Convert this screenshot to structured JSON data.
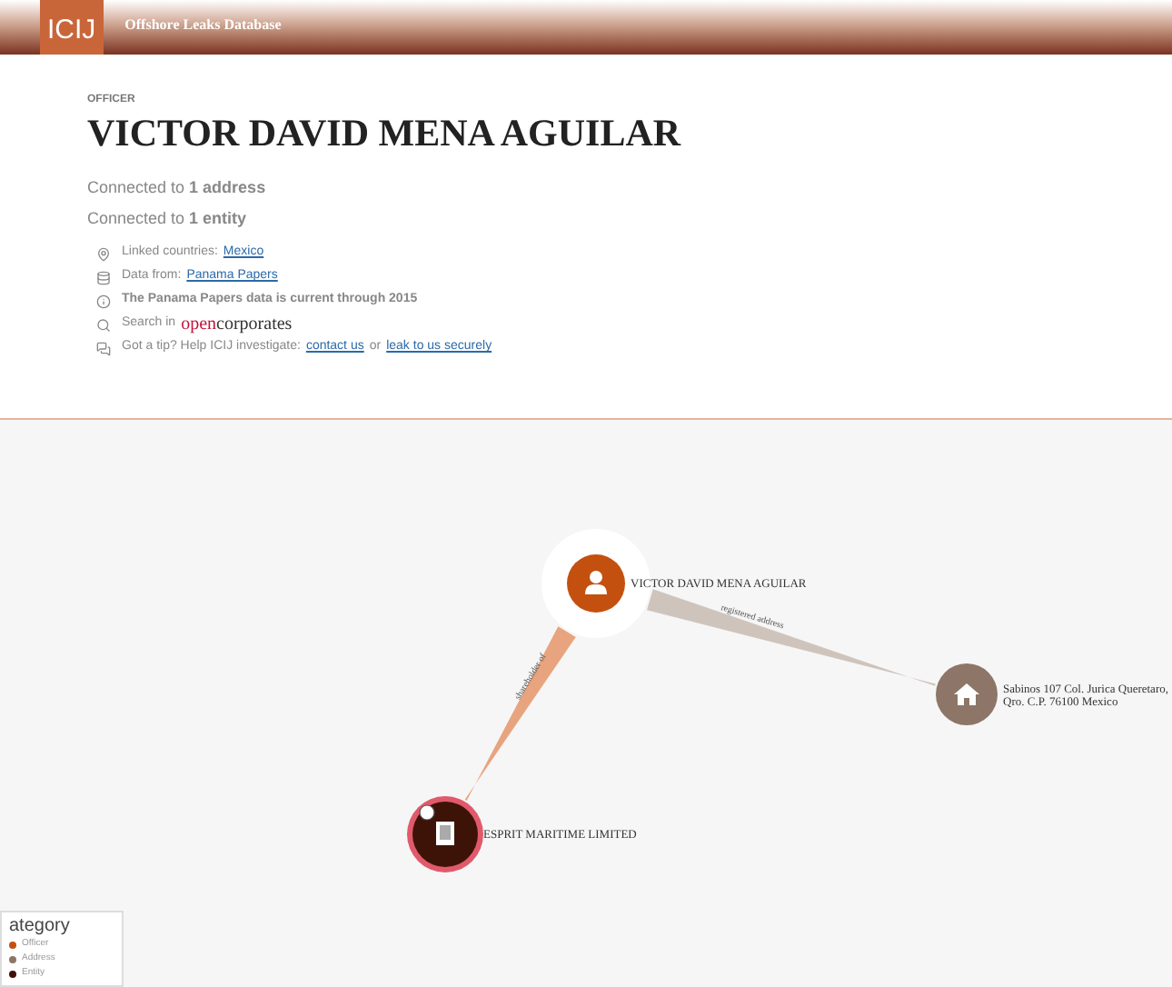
{
  "header": {
    "logo": "ICIJ",
    "title": "Offshore Leaks Database"
  },
  "profile": {
    "kicker": "OFFICER",
    "name": "VICTOR DAVID MENA AGUILAR",
    "connections": [
      "Connected to **1 address**",
      "Connected to **1 entity**"
    ],
    "info": [
      {
        "kind": "pin",
        "parts": [
          {
            "kind": "text",
            "text": "Linked countries:"
          },
          {
            "kind": "link",
            "text": "Mexico"
          }
        ]
      },
      {
        "kind": "database",
        "parts": [
          {
            "kind": "text",
            "text": "Data from:"
          },
          {
            "kind": "link",
            "text": "Panama Papers"
          }
        ]
      },
      {
        "kind": "info",
        "parts": [
          {
            "kind": "bold",
            "text": "The Panama Papers data is current through 2015"
          }
        ]
      },
      {
        "kind": "search",
        "parts": [
          {
            "kind": "text",
            "text": "Search in"
          },
          {
            "kind": "brand",
            "text": "open",
            "text2": "corporates"
          }
        ]
      },
      {
        "kind": "chat",
        "parts": [
          {
            "kind": "text",
            "text": "Got a tip? Help ICIJ investigate:"
          },
          {
            "kind": "link",
            "text": "contact us"
          },
          {
            "kind": "text",
            "text": "or"
          },
          {
            "kind": "link",
            "text": "leak to us securely"
          }
        ]
      }
    ]
  },
  "graph": {
    "nodes": [
      {
        "kind": "officer",
        "label": "VICTOR DAVID MENA AGUILAR",
        "selected": true
      },
      {
        "kind": "address",
        "label": "Sabinos 107 Col. Jurica Queretaro,",
        "label2": "Qro. C.P. 76100 Mexico",
        "selected": false
      },
      {
        "kind": "entity",
        "label": "ESPRIT MARITIME LIMITED",
        "selected": false
      }
    ],
    "edges": [
      {
        "kind": "shareholder",
        "label": "shareholder of"
      },
      {
        "kind": "address",
        "label": "registered address"
      }
    ],
    "legend": {
      "title": "ategory",
      "items": [
        {
          "kind": "officer",
          "label": "Officer"
        },
        {
          "kind": "address",
          "label": "Address"
        },
        {
          "kind": "entity",
          "label": "Entity"
        }
      ]
    }
  }
}
